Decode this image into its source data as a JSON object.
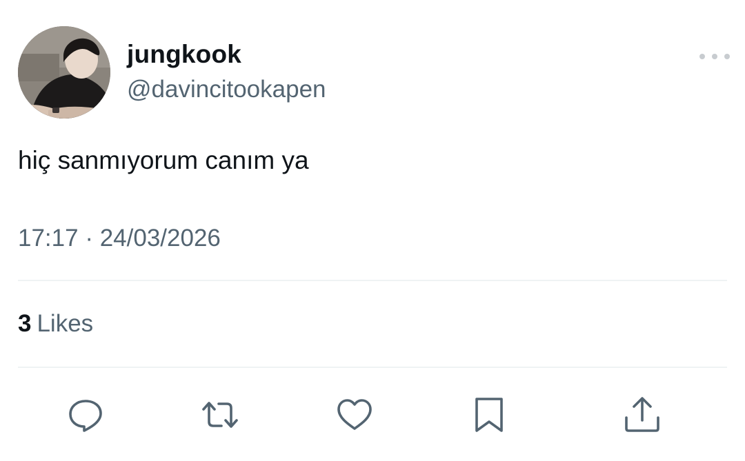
{
  "author": {
    "display_name": "jungkook",
    "handle": "@davincitookapen"
  },
  "tweet": {
    "text": "hiç sanmıyorum canım ya",
    "time": "17:17",
    "separator": "·",
    "date": "24/03/2026"
  },
  "stats": {
    "likes_count": "3",
    "likes_label": "Likes"
  },
  "actions": [
    {
      "icon": "reply-icon"
    },
    {
      "icon": "retweet-icon"
    },
    {
      "icon": "like-icon"
    },
    {
      "icon": "bookmark-icon"
    },
    {
      "icon": "share-icon"
    }
  ],
  "colors": {
    "primary_text": "#0f1419",
    "secondary_text": "#536471",
    "divider": "#eff3f4",
    "icon": "#536471"
  }
}
